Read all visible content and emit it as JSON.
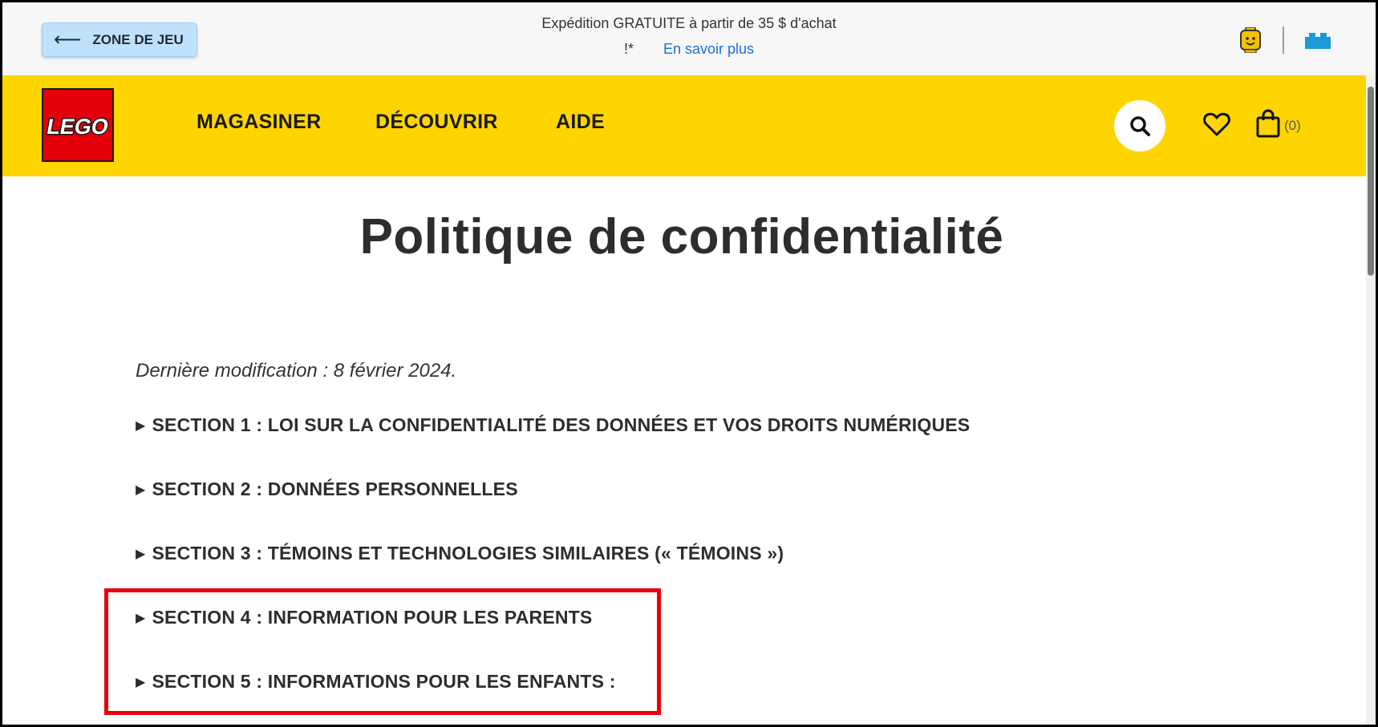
{
  "topbar": {
    "back_label": "ZONE DE JEU",
    "back_icon": "arrow-left-icon",
    "promo_line1": "Expédition GRATUITE à partir de 35 $ d'achat",
    "promo_line2": "!*",
    "promo_link": "En savoir plus",
    "icons": [
      "minifigure-head-icon",
      "lego-brick-icon"
    ]
  },
  "nav": {
    "logo_text": "LEGO",
    "items": [
      "MAGASINER",
      "DÉCOUVRIR",
      "AIDE"
    ],
    "search_icon": "search-icon",
    "wishlist_icon": "heart-icon",
    "bag_icon": "shopping-bag-icon",
    "bag_count": "(0)"
  },
  "main": {
    "title": "Politique de confidentialité",
    "last_modified": "Dernière modification : 8 février 2024.",
    "sections": [
      "SECTION 1 : LOI SUR LA CONFIDENTIALITÉ DES DONNÉES ET VOS DROITS NUMÉRIQUES",
      "SECTION 2 : DONNÉES PERSONNELLES",
      "SECTION 3 : TÉMOINS ET TECHNOLOGIES SIMILAIRES (« TÉMOINS »)",
      "SECTION 4 : INFORMATION POUR LES PARENTS",
      "SECTION 5 : INFORMATIONS POUR LES ENFANTS :"
    ],
    "expand_glyph": "▶"
  },
  "colors": {
    "nav_yellow": "#ffd500",
    "logo_red": "#e3000b",
    "back_button": "#bfe1fb",
    "link_blue": "#1a6fd8",
    "highlight_red": "#e8000b"
  }
}
